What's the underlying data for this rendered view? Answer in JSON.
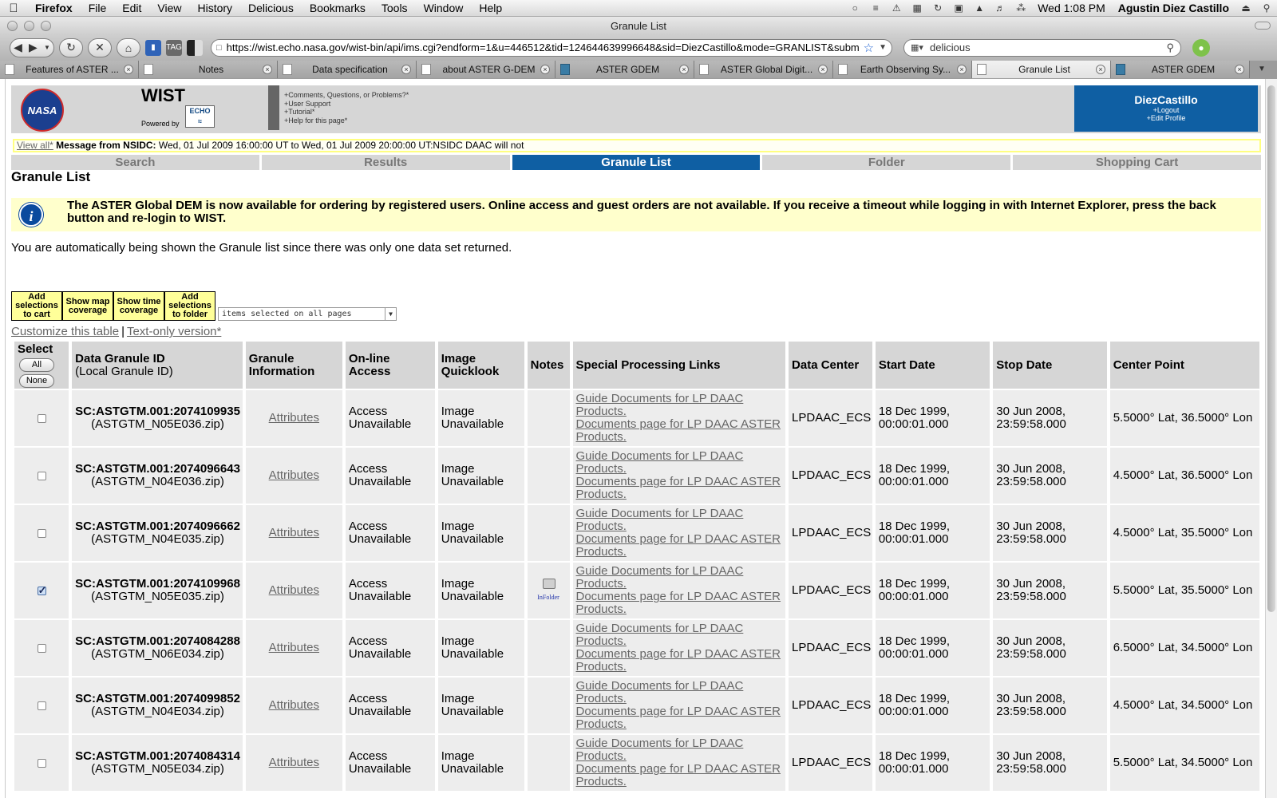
{
  "menubar": {
    "app_name": "Firefox",
    "items": [
      "File",
      "Edit",
      "View",
      "History",
      "Delicious",
      "Bookmarks",
      "Tools",
      "Window",
      "Help"
    ],
    "clock": "Wed 1:08 PM",
    "user": "Agustin Diez Castillo"
  },
  "window": {
    "title": "Granule List"
  },
  "toolbar": {
    "url": "https://wist.echo.nasa.gov/wist-bin/api/ims.cgi?endform=1&u=446512&tid=124644639996648&sid=DiezCastillo&mode=GRANLIST&subm",
    "search_text": "delicious"
  },
  "tabs": [
    {
      "label": "Features of ASTER ...",
      "active": false
    },
    {
      "label": "Notes",
      "active": false
    },
    {
      "label": "Data specification",
      "active": false
    },
    {
      "label": "about ASTER G-DEM",
      "active": false
    },
    {
      "label": "ASTER GDEM",
      "active": false
    },
    {
      "label": "ASTER Global Digit...",
      "active": false
    },
    {
      "label": "Earth Observing Sy...",
      "active": false
    },
    {
      "label": "Granule List",
      "active": true
    },
    {
      "label": "ASTER GDEM",
      "active": false
    }
  ],
  "header": {
    "logo_text": "NASA",
    "app_title": "WIST",
    "powered_by": "Powered by",
    "echo_logo": "ECHO",
    "help_links": [
      "+Comments, Questions, or Problems?*",
      "+User Support",
      "+Tutorial*",
      "+Help for this page*"
    ],
    "username": "DiezCastillo",
    "logout": "+Logout",
    "edit_profile": "+Edit Profile"
  },
  "message_bar": {
    "view_all": "View all*",
    "message_from": "Message from NSIDC:",
    "message_text": " Wed, 01 Jul 2009 16:00:00 UT to Wed, 01 Jul 2009 20:00:00 UT:NSIDC DAAC will not"
  },
  "main_tabs": [
    {
      "label": "Search",
      "active": false
    },
    {
      "label": "Results",
      "active": false
    },
    {
      "label": "Granule List",
      "active": true
    },
    {
      "label": "Folder",
      "active": false
    },
    {
      "label": "Shopping Cart",
      "active": false
    }
  ],
  "page": {
    "title": "Granule List",
    "notice": "The ASTER Global DEM is now available for ordering by registered users. Online access and guest orders are not available. If you receive a timeout while logging in with Internet Explorer, press the back button and re-login to WIST.",
    "auto_message": "You are automatically being shown the Granule list since there was only one data set returned."
  },
  "actions": {
    "add_to_cart": "Add selections to cart",
    "show_map": "Show map coverage",
    "show_time": "Show time coverage",
    "add_to_folder": "Add selections to folder",
    "selection_scope": "items selected on all pages",
    "customize": "Customize this table",
    "separator": "|",
    "text_only": "Text-only version*"
  },
  "table": {
    "headers": {
      "select": "Select",
      "all": "All",
      "none": "None",
      "granule_id": "Data Granule ID",
      "local_id": "(Local Granule ID)",
      "granule_info": "Granule Information",
      "online": "On-line Access",
      "quicklook": "Image Quicklook",
      "notes": "Notes",
      "special": "Special Processing Links",
      "data_center": "Data Center",
      "start": "Start Date",
      "stop": "Stop Date",
      "center": "Center Point"
    },
    "rows": [
      {
        "checked": false,
        "granule_id": "SC:ASTGTM.001:2074109935",
        "local_id": "(ASTGTM_N05E036.zip)",
        "info": "Attributes",
        "online": "Access Unavailable",
        "quicklook": "Image Unavailable",
        "note": "",
        "link1": "Guide Documents for LP DAAC Products.",
        "link1_a": "Guide Documents for LP DAAC",
        "link1_b": "Products.",
        "link2_a": "Documents page for LP DAAC ASTER",
        "link2_b": "Products.",
        "data_center": "LPDAAC_ECS",
        "start": "18 Dec 1999, 00:00:01.000",
        "stop": "30 Jun 2008, 23:59:58.000",
        "center": "5.5000° Lat, 36.5000° Lon"
      },
      {
        "checked": false,
        "granule_id": "SC:ASTGTM.001:2074096643",
        "local_id": "(ASTGTM_N04E036.zip)",
        "info": "Attributes",
        "online": "Access Unavailable",
        "quicklook": "Image Unavailable",
        "note": "",
        "link1_a": "Guide Documents for LP DAAC",
        "link1_b": "Products.",
        "link2_a": "Documents page for LP DAAC ASTER",
        "link2_b": "Products.",
        "data_center": "LPDAAC_ECS",
        "start": "18 Dec 1999, 00:00:01.000",
        "stop": "30 Jun 2008, 23:59:58.000",
        "center": "4.5000° Lat, 36.5000° Lon"
      },
      {
        "checked": false,
        "granule_id": "SC:ASTGTM.001:2074096662",
        "local_id": "(ASTGTM_N04E035.zip)",
        "info": "Attributes",
        "online": "Access Unavailable",
        "quicklook": "Image Unavailable",
        "note": "",
        "link1_a": "Guide Documents for LP DAAC",
        "link1_b": "Products.",
        "link2_a": "Documents page for LP DAAC ASTER",
        "link2_b": "Products.",
        "data_center": "LPDAAC_ECS",
        "start": "18 Dec 1999, 00:00:01.000",
        "stop": "30 Jun 2008, 23:59:58.000",
        "center": "4.5000° Lat, 35.5000° Lon"
      },
      {
        "checked": true,
        "granule_id": "SC:ASTGTM.001:2074109968",
        "local_id": "(ASTGTM_N05E035.zip)",
        "info": "Attributes",
        "online": "Access Unavailable",
        "quicklook": "Image Unavailable",
        "note": "InFolder",
        "link1_a": "Guide Documents for LP DAAC",
        "link1_b": "Products.",
        "link2_a": "Documents page for LP DAAC ASTER",
        "link2_b": "Products.",
        "data_center": "LPDAAC_ECS",
        "start": "18 Dec 1999, 00:00:01.000",
        "stop": "30 Jun 2008, 23:59:58.000",
        "center": "5.5000° Lat, 35.5000° Lon"
      },
      {
        "checked": false,
        "granule_id": "SC:ASTGTM.001:2074084288",
        "local_id": "(ASTGTM_N06E034.zip)",
        "info": "Attributes",
        "online": "Access Unavailable",
        "quicklook": "Image Unavailable",
        "note": "",
        "link1_a": "Guide Documents for LP DAAC",
        "link1_b": "Products.",
        "link2_a": "Documents page for LP DAAC ASTER",
        "link2_b": "Products.",
        "data_center": "LPDAAC_ECS",
        "start": "18 Dec 1999, 00:00:01.000",
        "stop": "30 Jun 2008, 23:59:58.000",
        "center": "6.5000° Lat, 34.5000° Lon"
      },
      {
        "checked": false,
        "granule_id": "SC:ASTGTM.001:2074099852",
        "local_id": "(ASTGTM_N04E034.zip)",
        "info": "Attributes",
        "online": "Access Unavailable",
        "quicklook": "Image Unavailable",
        "note": "",
        "link1_a": "Guide Documents for LP DAAC",
        "link1_b": "Products.",
        "link2_a": "Documents page for LP DAAC ASTER",
        "link2_b": "Products.",
        "data_center": "LPDAAC_ECS",
        "start": "18 Dec 1999, 00:00:01.000",
        "stop": "30 Jun 2008, 23:59:58.000",
        "center": "4.5000° Lat, 34.5000° Lon"
      },
      {
        "checked": false,
        "granule_id": "SC:ASTGTM.001:2074084314",
        "local_id": "(ASTGTM_N05E034.zip)",
        "info": "Attributes",
        "online": "Access Unavailable",
        "quicklook": "Image Unavailable",
        "note": "",
        "link1_a": "Guide Documents for LP DAAC",
        "link1_b": "Products.",
        "link2_a": "Documents page for LP DAAC ASTER",
        "link2_b": "Products.",
        "data_center": "LPDAAC_ECS",
        "start": "18 Dec 1999, 00:00:01.000",
        "stop": "30 Jun 2008, 23:59:58.000",
        "center": "5.5000° Lat, 34.5000° Lon"
      }
    ]
  },
  "icons": {
    "apple": "apple-icon",
    "back": "back-icon",
    "forward": "forward-icon",
    "reload": "reload-icon",
    "stop": "stop-icon",
    "home": "home-icon",
    "star": "bookmark-star-icon",
    "search": "search-icon",
    "info": "info-icon",
    "folder": "in-folder-icon"
  },
  "colors": {
    "brand_blue": "#0f5fa3",
    "notice_bg": "#ffffcc",
    "button_yellow": "#ffff99",
    "header_gray": "#d6d6d6",
    "row_gray": "#ededed"
  }
}
